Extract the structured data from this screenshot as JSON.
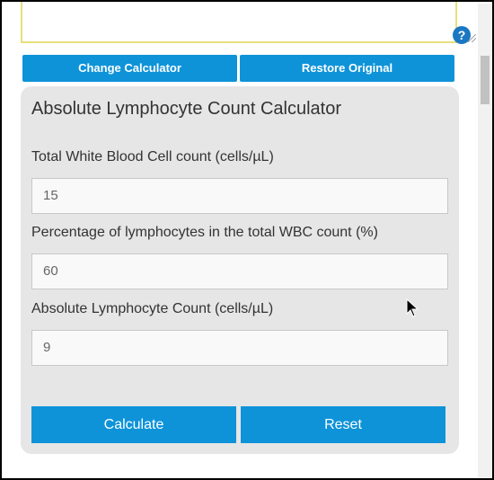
{
  "help_icon_glyph": "?",
  "buttons": {
    "change_calculator": "Change Calculator",
    "restore_original": "Restore Original"
  },
  "calculator": {
    "title": "Absolute Lymphocyte Count Calculator",
    "fields": [
      {
        "label": "Total White Blood Cell count (cells/µL)",
        "value": "15"
      },
      {
        "label": "Percentage of lymphocytes in the total WBC count (%)",
        "value": "60"
      },
      {
        "label": "Absolute Lymphocyte Count (cells/µL)",
        "value": "9"
      }
    ],
    "calculate_label": "Calculate",
    "reset_label": "Reset"
  },
  "colors": {
    "accent": "#0e93d9",
    "card_bg": "#e6e6e6",
    "textarea_border": "#e6e07a",
    "help_icon_bg": "#1a78c2"
  }
}
